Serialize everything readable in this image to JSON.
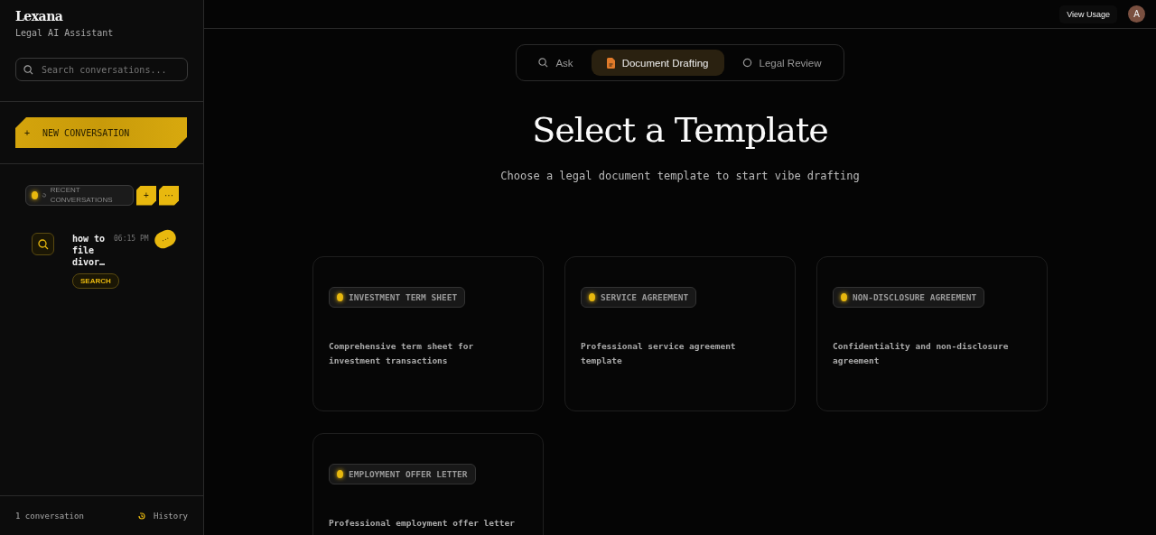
{
  "sidebar": {
    "brand": "Lexana",
    "tagline": "Legal AI Assistant",
    "search": {
      "placeholder": "Search conversations..."
    },
    "new_button": {
      "icon": "+",
      "label": "NEW CONVERSATION"
    },
    "recent": {
      "label": "RECENT CONVERSATIONS",
      "add": "+",
      "more": "···"
    },
    "conversations": [
      {
        "title": "how to file divor…",
        "time": "06:15 PM",
        "tag": "SEARCH",
        "more": "···"
      }
    ],
    "footer": {
      "count": "1 conversation",
      "history": "History"
    }
  },
  "topbar": {
    "usage": "View Usage",
    "avatar": "A"
  },
  "tabs": [
    {
      "label": "Ask",
      "kind": "search",
      "selected": false
    },
    {
      "label": "Document Drafting",
      "kind": "document",
      "selected": true
    },
    {
      "label": "Legal Review",
      "kind": "review",
      "selected": false
    }
  ],
  "heading": "Select a Template",
  "subheading": "Choose a legal document template to start vibe drafting",
  "templates": [
    {
      "tag": "INVESTMENT TERM SHEET",
      "description": "Comprehensive term sheet for investment transactions"
    },
    {
      "tag": "SERVICE AGREEMENT",
      "description": "Professional service agreement template"
    },
    {
      "tag": "NON-DISCLOSURE AGREEMENT",
      "description": "Confidentiality and non-disclosure agreement"
    },
    {
      "tag": "EMPLOYMENT OFFER LETTER",
      "description": "Professional employment offer letter"
    }
  ]
}
